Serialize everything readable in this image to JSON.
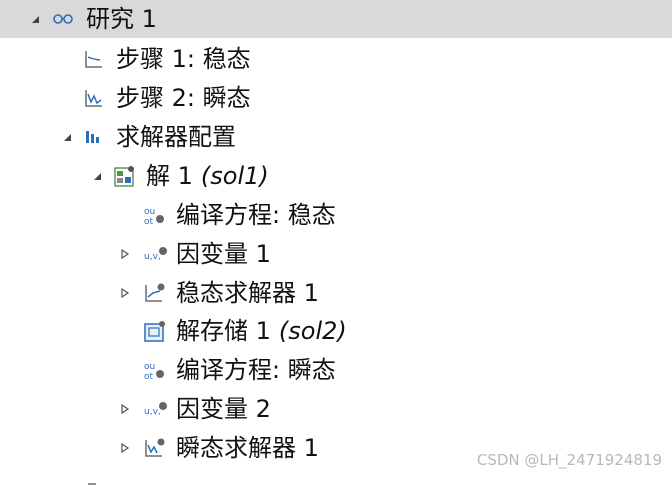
{
  "tree": {
    "study": {
      "label": "研究 1"
    },
    "step1": {
      "label": "步骤 1: 稳态"
    },
    "step2": {
      "label": "步骤 2: 瞬态"
    },
    "solver_configs": {
      "label": "求解器配置"
    },
    "solution1": {
      "label": "解 1",
      "tag": "(sol1)"
    },
    "compile_eq_stationary": {
      "label": "编译方程: 稳态"
    },
    "dependent_vars1": {
      "label": "因变量 1"
    },
    "stationary_solver": {
      "label": "稳态求解器 1"
    },
    "solution_store": {
      "label": "解存储 1",
      "tag": "(sol2)"
    },
    "compile_eq_transient": {
      "label": "编译方程: 瞬态"
    },
    "dependent_vars2": {
      "label": "因变量 2"
    },
    "time_solver": {
      "label": "瞬态求解器 1"
    }
  },
  "watermark": "CSDN @LH_2471924819",
  "colors": {
    "selection": "#d9d9d9",
    "accent_blue": "#2a6ebb",
    "icon_gray": "#6b6b6b"
  }
}
